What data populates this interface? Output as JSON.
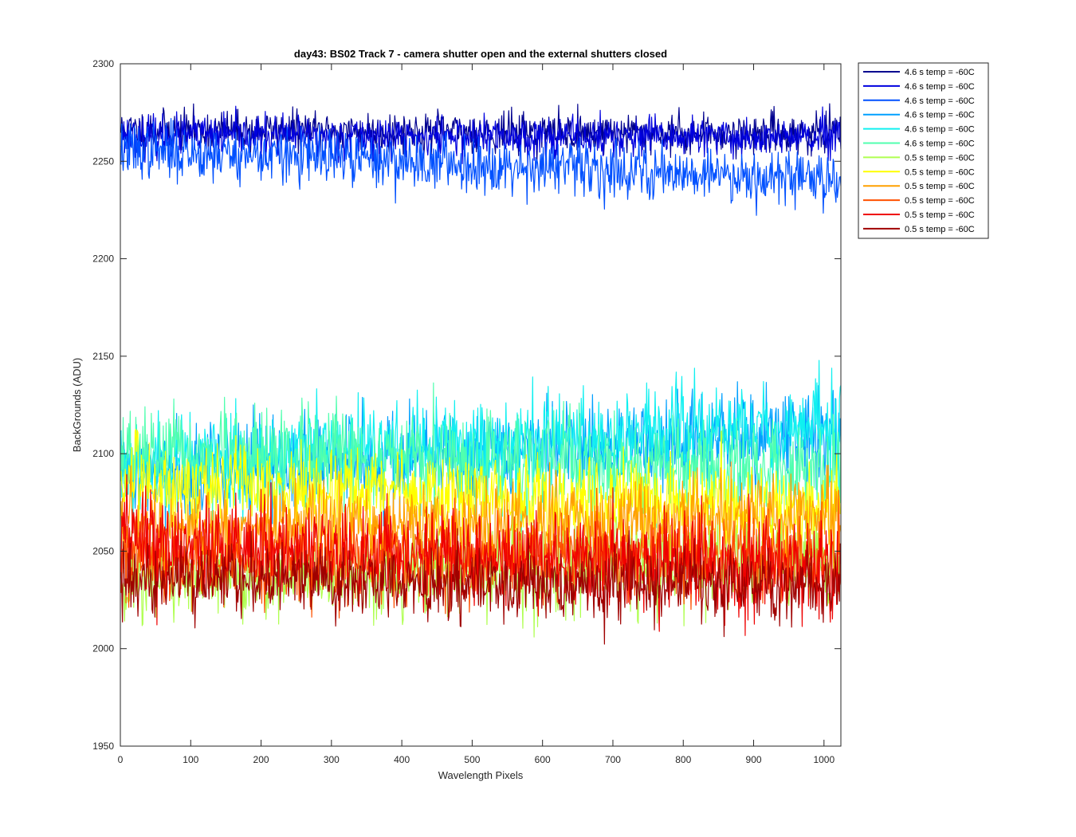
{
  "chart_data": {
    "type": "line",
    "title": "day43: BS02  Track 7 - camera shutter open and the external shutters closed",
    "xlabel": "Wavelength Pixels",
    "ylabel": "BackGrounds (ADU)",
    "xlim": [
      0,
      1024
    ],
    "ylim": [
      1950,
      2300
    ],
    "xticks": [
      0,
      100,
      200,
      300,
      400,
      500,
      600,
      700,
      800,
      900,
      1000
    ],
    "yticks": [
      1950,
      2000,
      2050,
      2100,
      2150,
      2200,
      2250,
      2300
    ],
    "grid": false,
    "legend_position": "outside-top-right",
    "n_points": 1024,
    "series": [
      {
        "name": "4.6 s temp = -60C",
        "color": "#00008F",
        "mean_start": 2266,
        "mean_end": 2264,
        "noise": 5,
        "seed": 11
      },
      {
        "name": "4.6 s temp = -60C",
        "color": "#0000DF",
        "mean_start": 2263,
        "mean_end": 2262,
        "noise": 5,
        "seed": 23
      },
      {
        "name": "4.6 s temp = -60C",
        "color": "#0050FF",
        "mean_start": 2256,
        "mean_end": 2241,
        "noise": 7,
        "seed": 37
      },
      {
        "name": "4.6 s temp = -60C",
        "color": "#00A0FF",
        "mean_start": 2090,
        "mean_end": 2110,
        "noise": 12,
        "seed": 41
      },
      {
        "name": "4.6 s temp = -60C",
        "color": "#10F0F0",
        "mean_start": 2095,
        "mean_end": 2115,
        "noise": 12,
        "seed": 53
      },
      {
        "name": "4.6 s temp = -60C",
        "color": "#50FFAF",
        "mean_start": 2098,
        "mean_end": 2092,
        "noise": 12,
        "seed": 67
      },
      {
        "name": "0.5 s temp = -60C",
        "color": "#AFFF50",
        "mean_start": 2035,
        "mean_end": 2045,
        "noise": 11,
        "seed": 71
      },
      {
        "name": "0.5 s temp = -60C",
        "color": "#FFFF00",
        "mean_start": 2085,
        "mean_end": 2072,
        "noise": 11,
        "seed": 83
      },
      {
        "name": "0.5 s temp = -60C",
        "color": "#FFA000",
        "mean_start": 2060,
        "mean_end": 2068,
        "noise": 11,
        "seed": 97
      },
      {
        "name": "0.5 s temp = -60C",
        "color": "#FF5000",
        "mean_start": 2045,
        "mean_end": 2048,
        "noise": 11,
        "seed": 101
      },
      {
        "name": "0.5 s temp = -60C",
        "color": "#EF0000",
        "mean_start": 2055,
        "mean_end": 2040,
        "noise": 12,
        "seed": 113
      },
      {
        "name": "0.5 s temp = -60C",
        "color": "#9F0000",
        "mean_start": 2035,
        "mean_end": 2033,
        "noise": 9,
        "seed": 127
      }
    ]
  }
}
